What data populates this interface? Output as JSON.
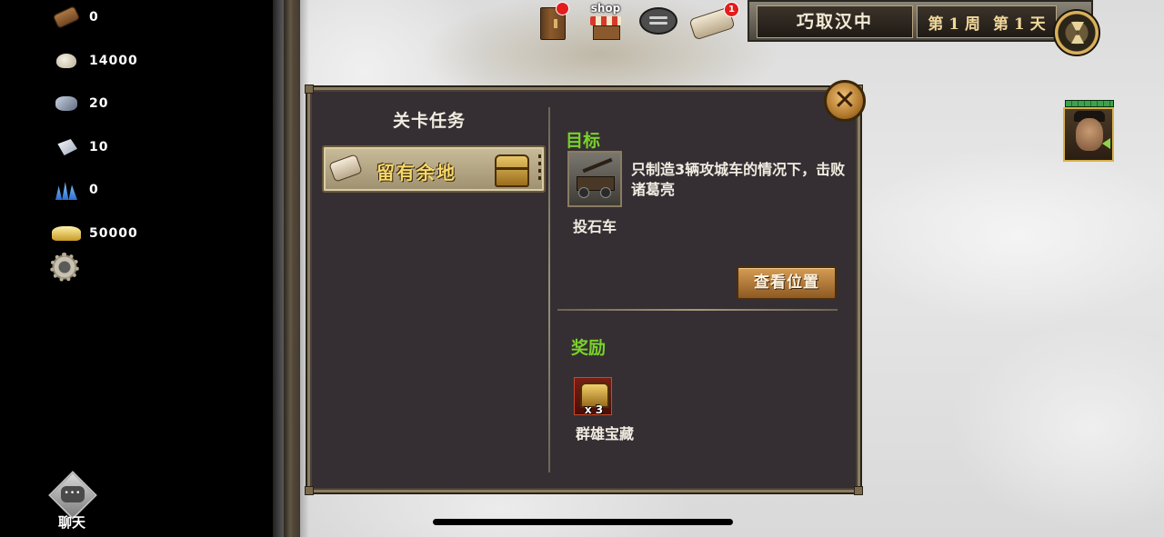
{
  "resources": [
    {
      "name": "wood",
      "icon": "wood-log-icon",
      "value": "0"
    },
    {
      "name": "stone",
      "icon": "stone-icon",
      "value": "14000"
    },
    {
      "name": "iron",
      "icon": "iron-ore-icon",
      "value": "20"
    },
    {
      "name": "silver",
      "icon": "silver-ingot-icon",
      "value": "10"
    },
    {
      "name": "crystal",
      "icon": "crystal-icon",
      "value": "0"
    },
    {
      "name": "gold",
      "icon": "gold-ingot-icon",
      "value": "50000"
    }
  ],
  "chat": {
    "label": "聊天",
    "glyph": "•••"
  },
  "topbar": {
    "shop_label": "shop",
    "map_badge": "1",
    "stage_name": "巧取汉中",
    "week_label": "第 1 周",
    "day_label": "第 1 天"
  },
  "dialog": {
    "mission_heading": "关卡任务",
    "mission_tab_label": "留有余地",
    "close_glyph": "✕",
    "objective_heading": "目标",
    "objective_unit": "投石车",
    "objective_text": "只制造3辆攻城车的情况下，击败诸葛亮",
    "view_location_label": "查看位置",
    "reward_heading": "奖励",
    "reward_qty": "x 3",
    "reward_label": "群雄宝藏"
  },
  "colors": {
    "dialog_bg": "#352f33",
    "heading_green": "#79d12a",
    "tab_gold_text": "#f6d86a",
    "badge_red": "#e41c1c"
  }
}
